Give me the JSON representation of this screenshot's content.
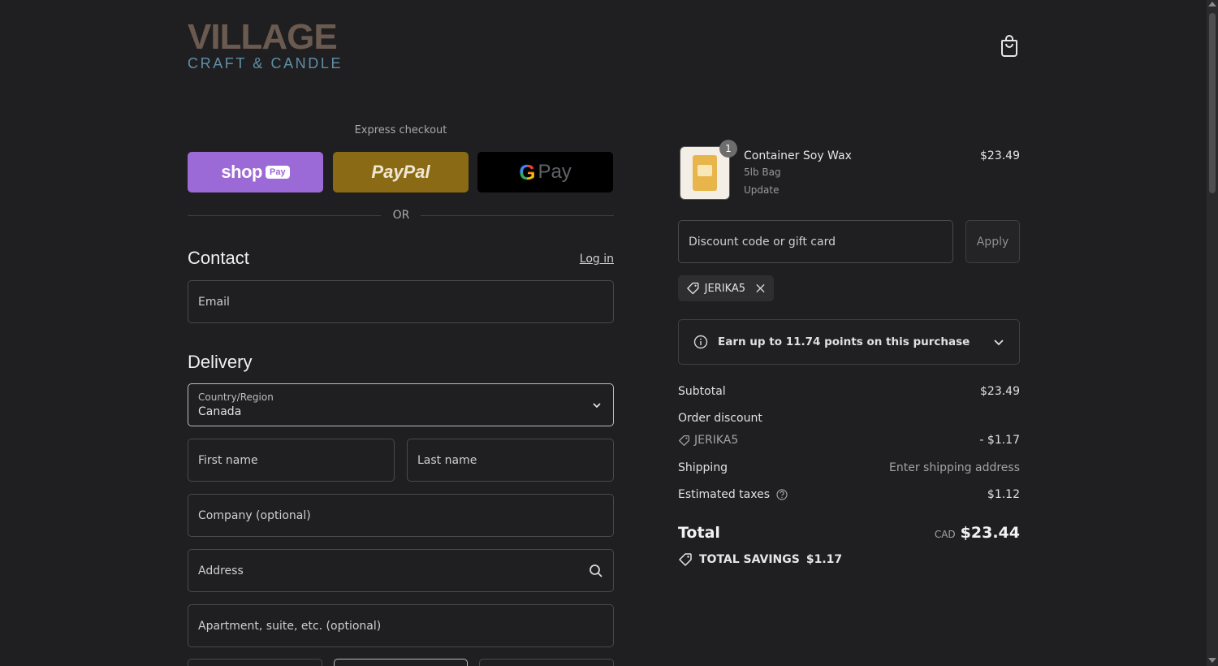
{
  "header": {
    "logo_main": "VILLAGE",
    "logo_sub": "CRAFT & CANDLE",
    "cart_icon": "shopping-bag-icon"
  },
  "express": {
    "label": "Express checkout",
    "shop_pay": {
      "word": "shop",
      "pill": "Pay"
    },
    "paypal": "PayPal",
    "gpay": {
      "g": "G",
      "word": "Pay"
    },
    "divider_text": "OR"
  },
  "contact": {
    "title": "Contact",
    "login_label": "Log in",
    "email_placeholder": "Email"
  },
  "delivery": {
    "title": "Delivery",
    "country_label": "Country/Region",
    "country_value": "Canada",
    "first_name_placeholder": "First name",
    "last_name_placeholder": "Last name",
    "company_placeholder": "Company (optional)",
    "address_placeholder": "Address",
    "apartment_placeholder": "Apartment, suite, etc. (optional)"
  },
  "order": {
    "item": {
      "quantity": "1",
      "name": "Container Soy Wax",
      "variant": "5lb Bag",
      "update_label": "Update",
      "price": "$23.49"
    },
    "discount_placeholder": "Discount code or gift card",
    "apply_label": "Apply",
    "applied_code": "JERIKA5",
    "points_text": "Earn up to 11.74 points on this purchase",
    "subtotal_label": "Subtotal",
    "subtotal_value": "$23.49",
    "order_discount_label": "Order discount",
    "discount_code": "JERIKA5",
    "discount_value": "- $1.17",
    "shipping_label": "Shipping",
    "shipping_value": "Enter shipping address",
    "taxes_label": "Estimated taxes",
    "taxes_value": "$1.12",
    "total_label": "Total",
    "total_currency": "CAD",
    "total_value": "$23.44",
    "savings_label": "TOTAL SAVINGS",
    "savings_value": "$1.17"
  },
  "colors": {
    "background": "#1f1f21",
    "shop_pay": "#9b6ad6",
    "paypal": "#8a6a14",
    "gpay": "#000000",
    "logo_brown": "#6b5a4f",
    "logo_teal": "#5f8fa6"
  }
}
